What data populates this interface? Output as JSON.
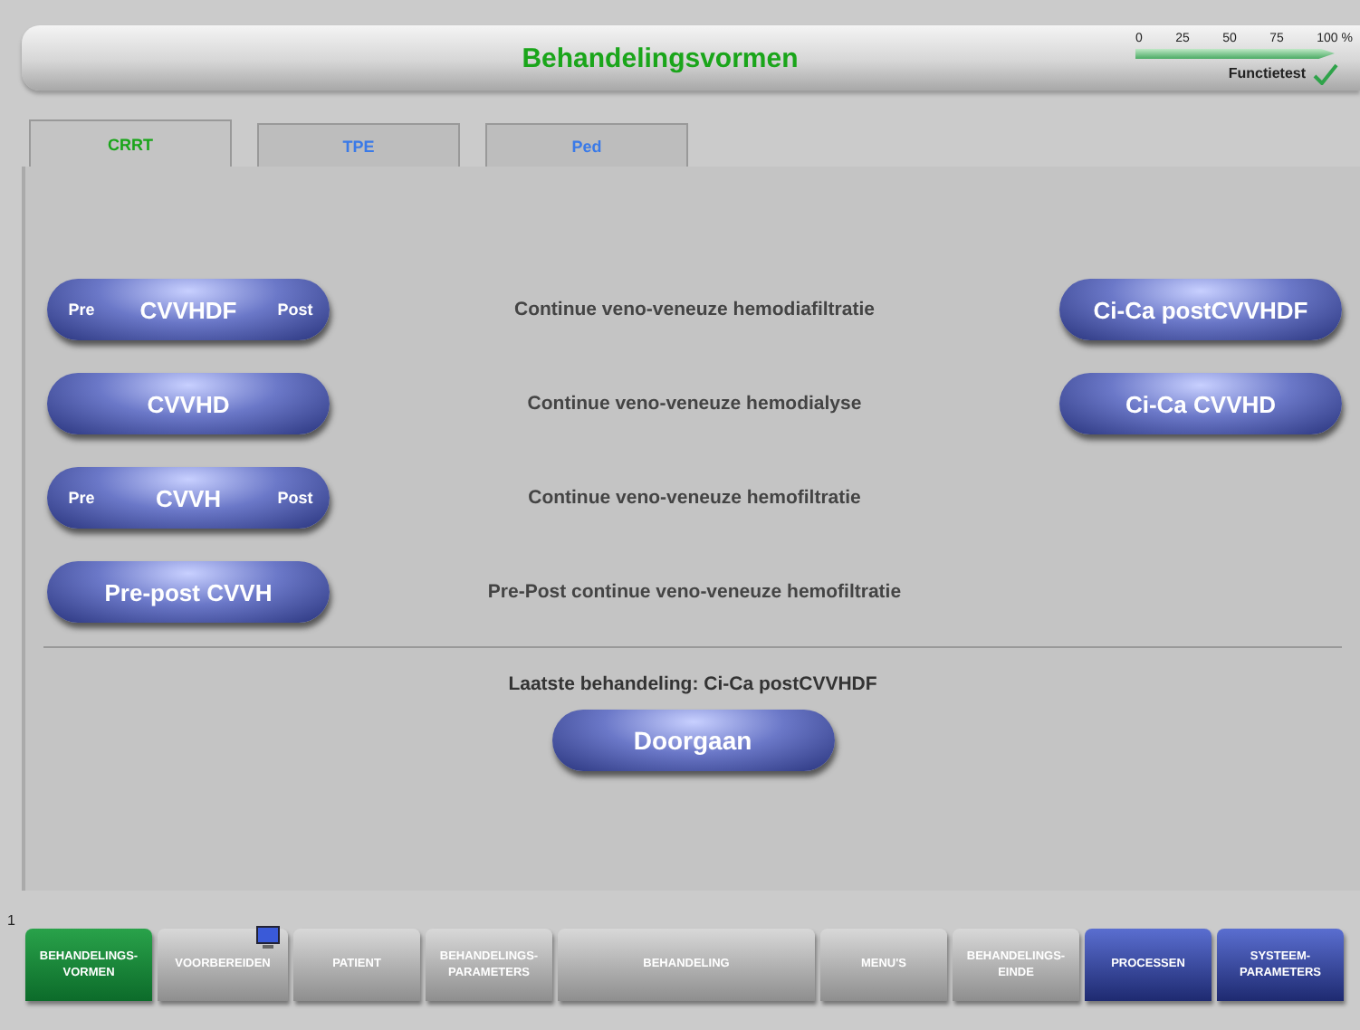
{
  "header": {
    "title": "Behandelingsvormen",
    "progress": {
      "ticks": [
        "0",
        "25",
        "50",
        "75",
        "100 %"
      ],
      "level": 1,
      "label": "Functietest",
      "done": true
    }
  },
  "tabs": [
    {
      "label": "CRRT",
      "selected": true
    },
    {
      "label": "TPE",
      "selected": false
    },
    {
      "label": "Ped",
      "selected": false
    }
  ],
  "therapies": [
    {
      "kind": "split",
      "pre": "Pre",
      "name": "CVVHDF",
      "post": "Post",
      "description": "Continue veno-veneuze hemodiafiltratie",
      "extra": "Ci-Ca postCVVHDF"
    },
    {
      "kind": "single",
      "name": "CVVHD",
      "description": "Continue veno-veneuze hemodialyse",
      "extra": "Ci-Ca CVVHD"
    },
    {
      "kind": "split",
      "pre": "Pre",
      "name": "CVVH",
      "post": "Post",
      "description": "Continue veno-veneuze hemofiltratie"
    },
    {
      "kind": "single",
      "name": "Pre-post CVVH",
      "description": "Pre-Post continue veno-veneuze hemofiltratie"
    }
  ],
  "last_treatment": "Laatste behandeling: Ci-Ca postCVVHDF",
  "continue_button": "Doorgaan",
  "step_number": "1",
  "nav": [
    {
      "lines": [
        "BEHANDELINGS-",
        "VORMEN"
      ],
      "kind": "step",
      "selected": true
    },
    {
      "lines": [
        "VOORBEREIDEN"
      ],
      "kind": "step",
      "selected": false,
      "monitor": true
    },
    {
      "lines": [
        "PATIENT"
      ],
      "kind": "step",
      "selected": false
    },
    {
      "lines": [
        "BEHANDELINGS-",
        "PARAMETERS"
      ],
      "kind": "step",
      "selected": false
    },
    {
      "lines": [
        "BEHANDELING"
      ],
      "kind": "step",
      "selected": false
    },
    {
      "lines": [
        "MENU'S"
      ],
      "kind": "step",
      "selected": false
    },
    {
      "lines": [
        "BEHANDELINGS-",
        "EINDE"
      ],
      "kind": "step",
      "selected": false
    },
    {
      "lines": [
        "PROCESSEN"
      ],
      "kind": "system",
      "selected": false
    },
    {
      "lines": [
        "SYSTEEM-",
        "PARAMETERS"
      ],
      "kind": "system",
      "selected": false
    }
  ]
}
